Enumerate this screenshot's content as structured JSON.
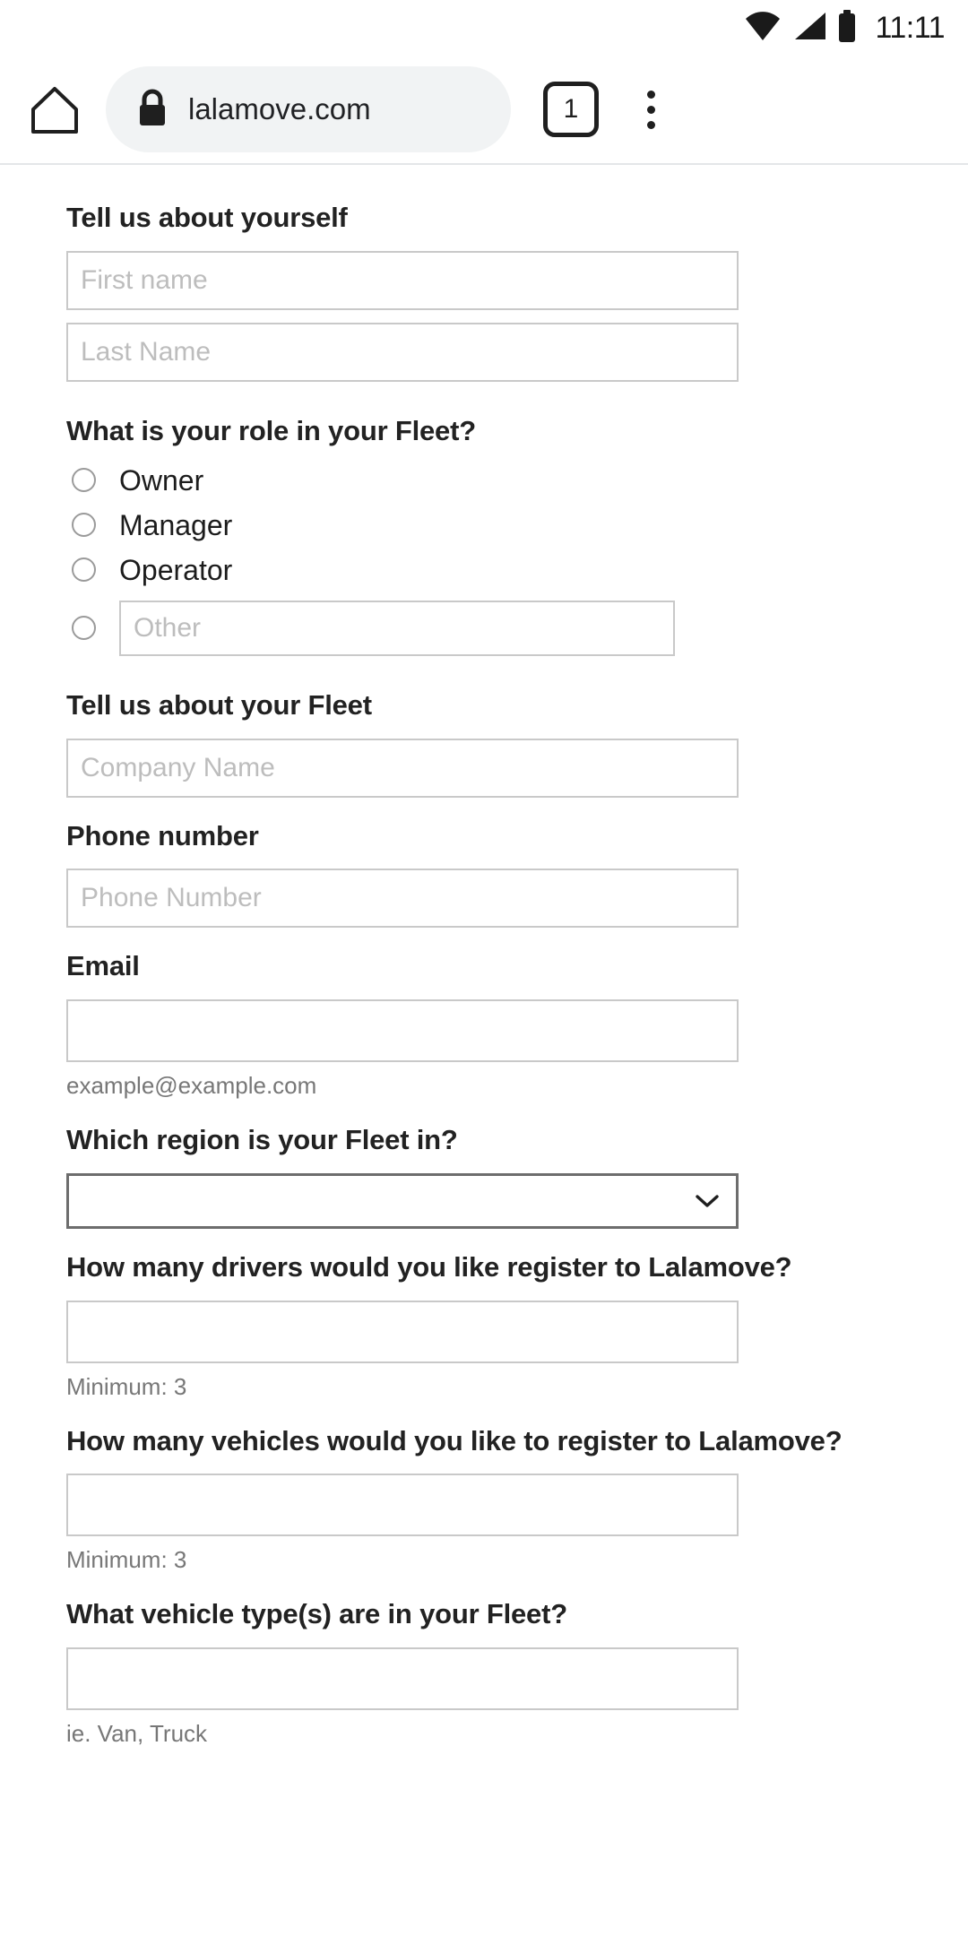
{
  "status_bar": {
    "wifi_icon": "wifi-icon",
    "signal_icon": "cellular-signal-icon",
    "battery_icon": "battery-icon",
    "clock": "11:11"
  },
  "browser": {
    "home_icon": "home-icon",
    "lock_icon": "lock-icon",
    "url": "lalamove.com",
    "tab_count": "1",
    "menu_icon": "overflow-menu-icon"
  },
  "form": {
    "yourself": {
      "heading": "Tell us about yourself",
      "first_name_placeholder": "First name",
      "first_name_value": "",
      "last_name_placeholder": "Last Name",
      "last_name_value": ""
    },
    "role": {
      "heading": "What is your role in your Fleet?",
      "options": [
        {
          "label": "Owner",
          "selected": false
        },
        {
          "label": "Manager",
          "selected": false
        },
        {
          "label": "Operator",
          "selected": false
        }
      ],
      "other": {
        "selected": false,
        "placeholder": "Other",
        "value": ""
      }
    },
    "fleet": {
      "heading": "Tell us about your Fleet",
      "company_placeholder": "Company Name",
      "company_value": ""
    },
    "phone": {
      "heading": "Phone number",
      "placeholder": "Phone Number",
      "value": ""
    },
    "email": {
      "heading": "Email",
      "placeholder": "",
      "value": "",
      "hint": "example@example.com"
    },
    "region": {
      "heading": "Which region is your Fleet in?",
      "selected": "",
      "options": [
        ""
      ],
      "chevron_icon": "chevron-down-icon"
    },
    "drivers": {
      "heading": "How many drivers would you like register to Lalamove?",
      "value": "",
      "hint": "Minimum: 3"
    },
    "vehicles": {
      "heading": "How many vehicles would you like to register to Lalamove?",
      "value": "",
      "hint": "Minimum: 3"
    },
    "vehicle_types": {
      "heading": "What vehicle type(s) are in your Fleet?",
      "value": "",
      "hint": "ie. Van, Truck"
    }
  },
  "colors": {
    "text": "#222222",
    "placeholder": "#bdbdbd",
    "border": "#c9c9c9",
    "hint": "#777777",
    "omnibox_bg": "#f1f3f4"
  }
}
